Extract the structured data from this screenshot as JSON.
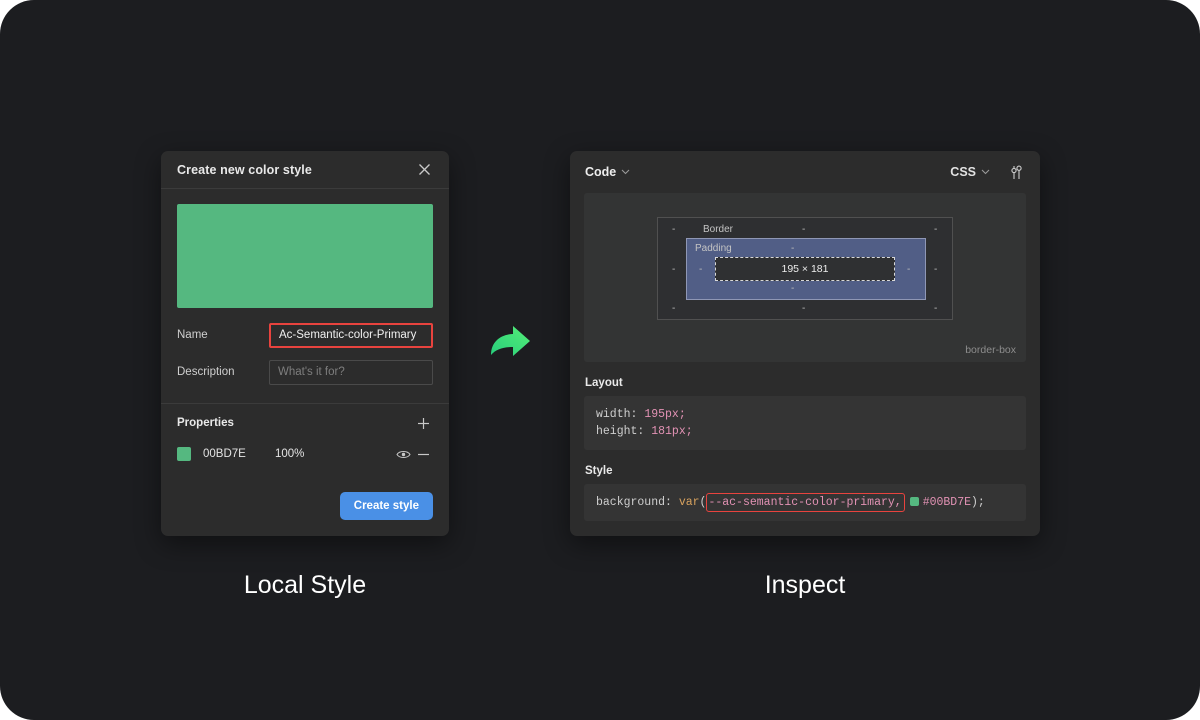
{
  "canvas": {
    "background": "#1c1d20"
  },
  "local_style": {
    "dialog_title": "Create new color style",
    "close_icon": "close-icon",
    "preview_color": "#55B880",
    "name_label": "Name",
    "name_value": "Ac-Semantic-color-Primary",
    "description_label": "Description",
    "description_placeholder": "What's it for?",
    "properties_label": "Properties",
    "add_icon": "plus-icon",
    "property": {
      "swatch_color": "#55B880",
      "hex": "00BD7E",
      "opacity": "100%",
      "visibility_icon": "eye-icon",
      "remove_icon": "minus-icon"
    },
    "create_button": "Create style",
    "highlight_color": "#E8433E",
    "accent_color": "#4A90E6"
  },
  "arrow": {
    "icon": "curved-arrow-right-icon",
    "color_start": "#2BD67B",
    "color_end": "#4DE877"
  },
  "inspect": {
    "code_label": "Code",
    "code_chevron_icon": "chevron-down-icon",
    "language_label": "CSS",
    "language_chevron_icon": "chevron-down-icon",
    "settings_icon": "sliders-icon",
    "box_model": {
      "margin_label": "",
      "border_label": "Border",
      "padding_label": "Padding",
      "content_size": "195 × 181",
      "dash": "-",
      "box_sizing": "border-box",
      "padding_fill": "#515E86"
    },
    "layout": {
      "title": "Layout",
      "lines": [
        {
          "prop": "width:",
          "value": "195px;"
        },
        {
          "prop": "height:",
          "value": "181px;"
        }
      ]
    },
    "style": {
      "title": "Style",
      "property": "background:",
      "function": "var",
      "open_paren": "(",
      "variable": "--ac-semantic-color-primary,",
      "swatch_color": "#00BD7E",
      "fallback": "#00BD7E",
      "close": ");"
    }
  },
  "captions": {
    "left": "Local Style",
    "right": "Inspect"
  }
}
